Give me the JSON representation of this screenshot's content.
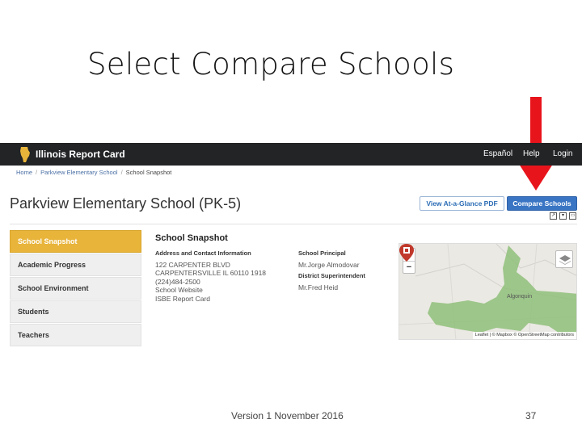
{
  "slide": {
    "title": "Select Compare Schools",
    "footer": "Version 1   November 2016",
    "page_number": "37"
  },
  "topbar": {
    "brand": "Illinois Report Card",
    "links": [
      "Español",
      "Help",
      "Login"
    ]
  },
  "breadcrumb": {
    "home": "Home",
    "school": "Parkview Elementary School",
    "current": "School Snapshot"
  },
  "school": {
    "name": "Parkview Elementary School",
    "grades": "(PK-5)"
  },
  "buttons": {
    "glance": "View At-a-Glance PDF",
    "compare": "Compare Schools"
  },
  "sidebar": {
    "items": [
      "School Snapshot",
      "Academic Progress",
      "School Environment",
      "Students",
      "Teachers"
    ],
    "active": "School Snapshot"
  },
  "snapshot": {
    "heading": "School Snapshot",
    "address_label": "Address and Contact Information",
    "address_line1": "122 CARPENTER BLVD",
    "address_line2": "CARPENTERSVILLE IL 60110 1918",
    "phone": "(224)484-2500",
    "website": "School Website",
    "report_card": "ISBE Report Card",
    "principal_label": "School Principal",
    "principal": "Mr.Jorge Almodovar",
    "superintendent_label": "District Superintendent",
    "superintendent": "Mr.Fred Heid"
  },
  "map": {
    "zoom_in": "+",
    "zoom_out": "−",
    "town": "Algonquin",
    "attribution": "Leaflet | © Mapbox © OpenStreetMap contributors",
    "colors": {
      "park": "#8fbf7a",
      "land": "#e9e7e2",
      "pin": "#c0392b"
    }
  },
  "colors": {
    "topbar": "#222426",
    "active_tab": "#e8b43a",
    "compare_button": "#3a75c4",
    "arrow": "#e8141c"
  }
}
